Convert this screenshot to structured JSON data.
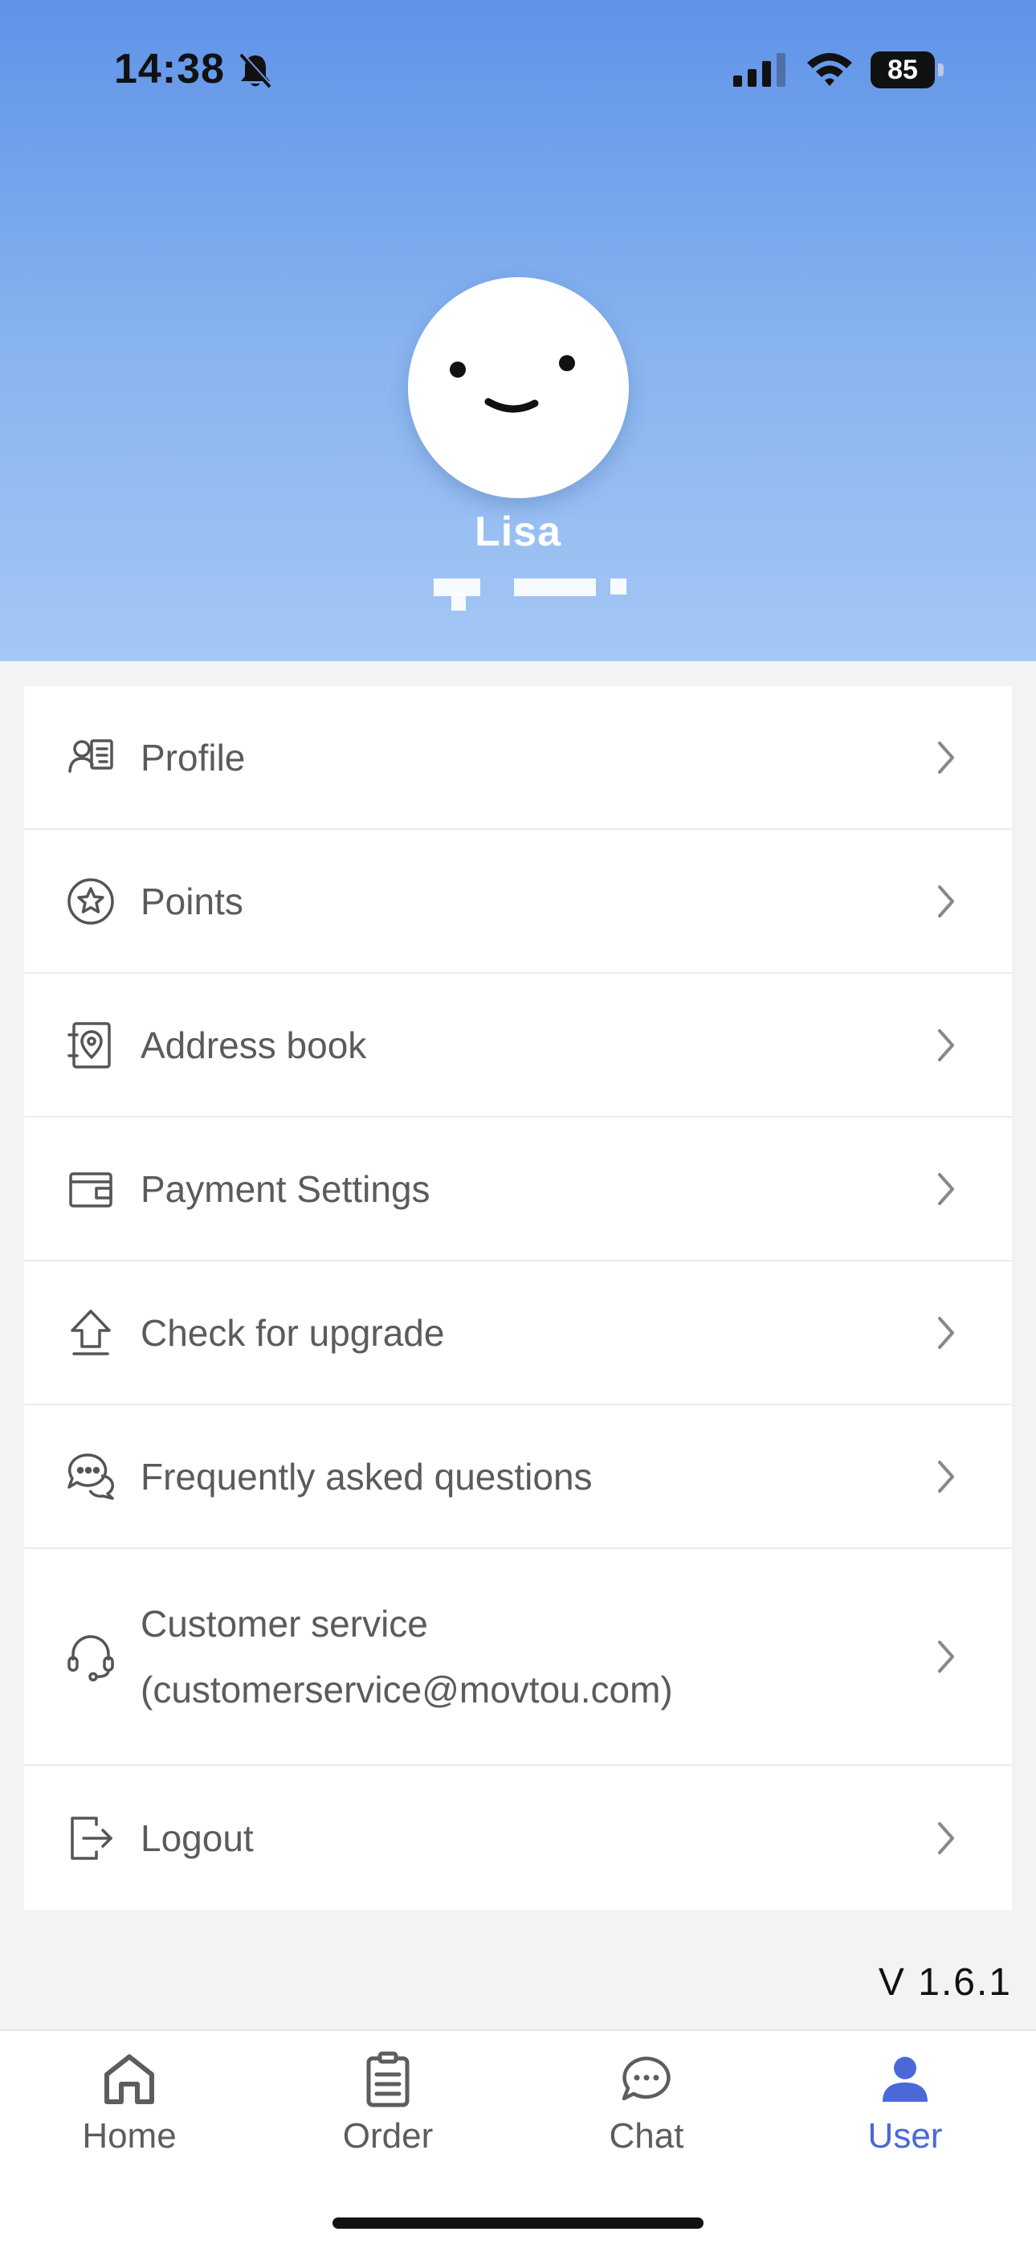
{
  "status_bar": {
    "time": "14:38",
    "battery": "85"
  },
  "profile": {
    "name": "Lisa"
  },
  "menu": [
    {
      "label": "Profile",
      "icon": "profile-card-icon"
    },
    {
      "label": "Points",
      "icon": "star-circle-icon"
    },
    {
      "label": "Address book",
      "icon": "address-book-icon"
    },
    {
      "label": "Payment Settings",
      "icon": "wallet-icon"
    },
    {
      "label": "Check for upgrade",
      "icon": "upload-arrow-icon"
    },
    {
      "label": "Frequently asked questions",
      "icon": "chat-bubbles-icon"
    },
    {
      "label": "Customer service",
      "sublabel": "(customerservice@movtou.com)",
      "icon": "headset-icon"
    },
    {
      "label": "Logout",
      "icon": "logout-icon"
    }
  ],
  "version": "V 1.6.1",
  "tabs": [
    {
      "label": "Home",
      "icon": "home-icon"
    },
    {
      "label": "Order",
      "icon": "clipboard-icon"
    },
    {
      "label": "Chat",
      "icon": "chat-icon"
    },
    {
      "label": "User",
      "icon": "user-icon",
      "active": true
    }
  ],
  "colors": {
    "accent": "#4a68d8",
    "header_top": "#5f93e8",
    "header_bottom": "#a4c7f4"
  }
}
